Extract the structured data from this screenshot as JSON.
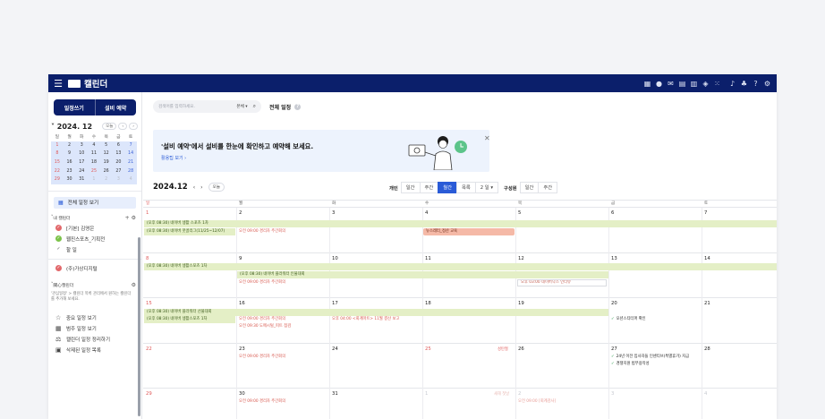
{
  "app": {
    "title": "캘린더"
  },
  "topbar": {
    "icons": [
      "grid-icon",
      "chat-icon",
      "mail-icon",
      "calendar-icon",
      "doc-icon",
      "cube-icon",
      "apps-icon",
      "bell-icon",
      "org-icon",
      "help-icon",
      "settings-icon"
    ]
  },
  "sidebar": {
    "tabs": [
      "일정쓰기",
      "설비 예약"
    ],
    "mini": {
      "ym": "2024. 12",
      "today_btn": "오늘",
      "dow": [
        "일",
        "월",
        "화",
        "수",
        "목",
        "금",
        "토"
      ],
      "weeks": [
        [
          "1",
          "2",
          "3",
          "4",
          "5",
          "6",
          "7"
        ],
        [
          "8",
          "9",
          "10",
          "11",
          "12",
          "13",
          "14"
        ],
        [
          "15",
          "16",
          "17",
          "18",
          "19",
          "20",
          "21"
        ],
        [
          "22",
          "23",
          "24",
          "25",
          "26",
          "27",
          "28"
        ],
        [
          "29",
          "30",
          "31",
          "1",
          "2",
          "3",
          "4"
        ]
      ]
    },
    "all_view": "전체 일정 보기",
    "my_calendars_label": "내 캘린더",
    "calendars": [
      {
        "name": "[기본] 김영은",
        "color": "#e2686b",
        "checked": true
      },
      {
        "name": "웹진스포츠_기획전",
        "color": "#7cc34a",
        "checked": true
      },
      {
        "name": "할 일",
        "color": "",
        "checked": false
      },
      {
        "name": "(주)가상디지털",
        "color": "#e2686b",
        "checked": true
      }
    ],
    "shared_label": "關心캘린더",
    "shared_note": "'관심일정' > 캘린더 목록 관리에서 원하는 캘린더를 추가해 보세요.",
    "shortcuts": [
      "중요 일정 보기",
      "범주 일정 보기",
      "캘린더 일정 정리하기",
      "삭제된 일정 목록"
    ]
  },
  "search": {
    "placeholder": "검색어를 입력하세요.",
    "scope": "본체 ▾"
  },
  "all_schedule_title": "전체 일정",
  "banner": {
    "text": "'설비 예약'에서 설비를 한눈에 확인하고 예약해 보세요.",
    "link": "활용팁 보기 ›"
  },
  "calendar": {
    "current": "2024.12",
    "today_btn": "오늘",
    "personal_label": "개인",
    "personal_views": [
      "일간",
      "주간",
      "월간",
      "목록",
      "2 일 ▾"
    ],
    "member_label": "구성원",
    "member_views": [
      "일간",
      "주간"
    ],
    "dow": [
      "일",
      "월",
      "화",
      "수",
      "목",
      "금",
      "토"
    ],
    "weeks": [
      {
        "days": [
          "1",
          "2",
          "3",
          "4",
          "5",
          "6",
          "7"
        ],
        "bars": [
          "(오후 08:30) 네이버 생활 스포츠 1차",
          "(오후 08:30) 네이버 웃골리그(11/25~12/07)"
        ],
        "events": {
          "mon": "오전 09:00 경리자 주간회의",
          "thu": "뉴스레터_정산 교육"
        }
      },
      {
        "days": [
          "8",
          "9",
          "10",
          "11",
          "12",
          "13",
          "14"
        ],
        "bars": [
          "(오후 08:30) 네이버 생활스포츠 1차",
          "(오후 08:30) 네이버 플라워터 인물대회"
        ],
        "events": {
          "mon": "오전 09:00 경리자 주간회의",
          "fri": "오후 03:00 네이버닥스 인터뷰"
        }
      },
      {
        "days": [
          "15",
          "16",
          "17",
          "18",
          "19",
          "20",
          "21"
        ],
        "bars": [
          "(오후 08:30) 네이버 플라워터 선물대회",
          "(오후 08:30) 네이버 생활스포츠 1차"
        ],
        "events": {
          "mon": "오전 09:00 경리자 주간회의",
          "mon2": "오전 09:30 도메시털_피트 점검",
          "tue": "오후 04:00 <회계마트> 11월 결산 보고",
          "sat": "오션스티터퍼 확인"
        }
      },
      {
        "days": [
          "22",
          "23",
          "24",
          "25",
          "26",
          "27",
          "28"
        ],
        "holiday": "성탄절",
        "events": {
          "mon": "오전 09:00 경리자 주간회의",
          "sat": "24년 이전 입사자들 인센티브(특별휴가) 지급",
          "sat2": "경쟁지원 법무용작성"
        }
      },
      {
        "days": [
          "29",
          "30",
          "31",
          "1",
          "2",
          "3",
          "4"
        ],
        "holiday": "새해 첫날",
        "events": {
          "mon": "오전 09:00 경리자 주간회의",
          "thu": "오전 09:00 [회계감사]"
        }
      }
    ]
  }
}
